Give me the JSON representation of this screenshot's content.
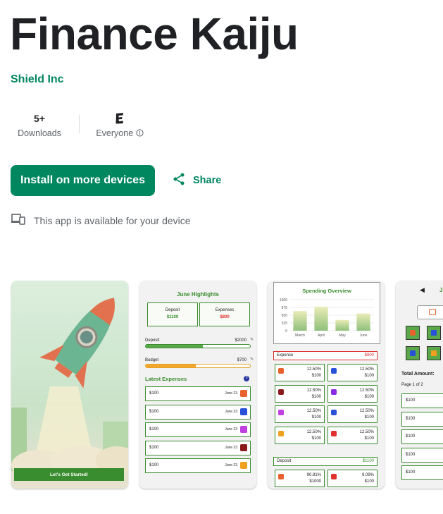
{
  "app": {
    "title": "Finance Kaiju",
    "developer": "Shield Inc"
  },
  "stats": {
    "downloads_value": "5+",
    "downloads_label": "Downloads",
    "rating_label": "Everyone"
  },
  "actions": {
    "install_label": "Install on more devices",
    "share_label": "Share"
  },
  "availability": {
    "text": "This app is available for your device"
  },
  "screens": {
    "s1": {
      "cta": "Let's Get Started!"
    },
    "s2": {
      "title": "June Highlights",
      "deposit_label": "Deposit",
      "deposit_value": "$1100",
      "expenses_label": "Expenses",
      "expenses_value": "$800",
      "deposit_bar_label": "Deposit",
      "deposit_bar_value": "$2000",
      "deposit_progress": 0.55,
      "budget_bar_label": "Budget",
      "budget_bar_value": "$700",
      "budget_progress": 0.48,
      "latest_title": "Latest Expenses",
      "items": [
        {
          "amount": "$100",
          "date": "June 23",
          "icon": "food-icon",
          "color": "#e8602c"
        },
        {
          "amount": "$100",
          "date": "June 23",
          "icon": "gift-icon",
          "color": "#2850d8"
        },
        {
          "amount": "$100",
          "date": "June 23",
          "icon": "gamepad-icon",
          "color": "#c040e0"
        },
        {
          "amount": "$100",
          "date": "June 23",
          "icon": "bolt-icon",
          "color": "#8b1a1a"
        },
        {
          "amount": "$100",
          "date": "June 23",
          "icon": "home-icon",
          "color": "#f0a020"
        }
      ]
    },
    "s3": {
      "title": "Spending Overview",
      "chart": {
        "months": [
          "March",
          "April",
          "May",
          "June"
        ],
        "values": [
          820,
          1000,
          450,
          720
        ],
        "yticks": [
          "1300",
          "975",
          "650",
          "325",
          "0"
        ]
      },
      "expense_label": "Expense",
      "expense_value": "$800",
      "tiles": [
        {
          "pct": "12.50%",
          "amt": "$100",
          "icon": "food-icon",
          "color": "#e8602c"
        },
        {
          "pct": "12.50%",
          "amt": "$100",
          "icon": "gift-icon",
          "color": "#2850d8"
        },
        {
          "pct": "12.50%",
          "amt": "$100",
          "icon": "bolt-icon",
          "color": "#8b1a1a"
        },
        {
          "pct": "12.50%",
          "amt": "$100",
          "icon": "graduation-icon",
          "color": "#8a2be2"
        },
        {
          "pct": "12.50%",
          "amt": "$100",
          "icon": "gamepad-icon",
          "color": "#c040e0"
        },
        {
          "pct": "12.50%",
          "amt": "$100",
          "icon": "bus-icon",
          "color": "#2850d8"
        },
        {
          "pct": "12.50%",
          "amt": "$100",
          "icon": "home-icon",
          "color": "#f0a020"
        },
        {
          "pct": "12.50%",
          "amt": "$100",
          "icon": "more-icon",
          "color": "#e03030"
        }
      ],
      "deposit_label": "Deposit",
      "deposit_value": "$1100",
      "dep_tiles": [
        {
          "pct": "90.91%",
          "amt": "$1000",
          "icon": "wallet-icon",
          "color": "#e8602c"
        },
        {
          "pct": "9.09%",
          "amt": "$100",
          "icon": "dollar-icon",
          "color": "#e03030"
        }
      ]
    },
    "s4": {
      "header": "J",
      "total_label": "Total Amount: ",
      "page_label": "Page 1 of 2",
      "rows": [
        "$100",
        "$100",
        "$100",
        "$100",
        "$100"
      ]
    }
  }
}
